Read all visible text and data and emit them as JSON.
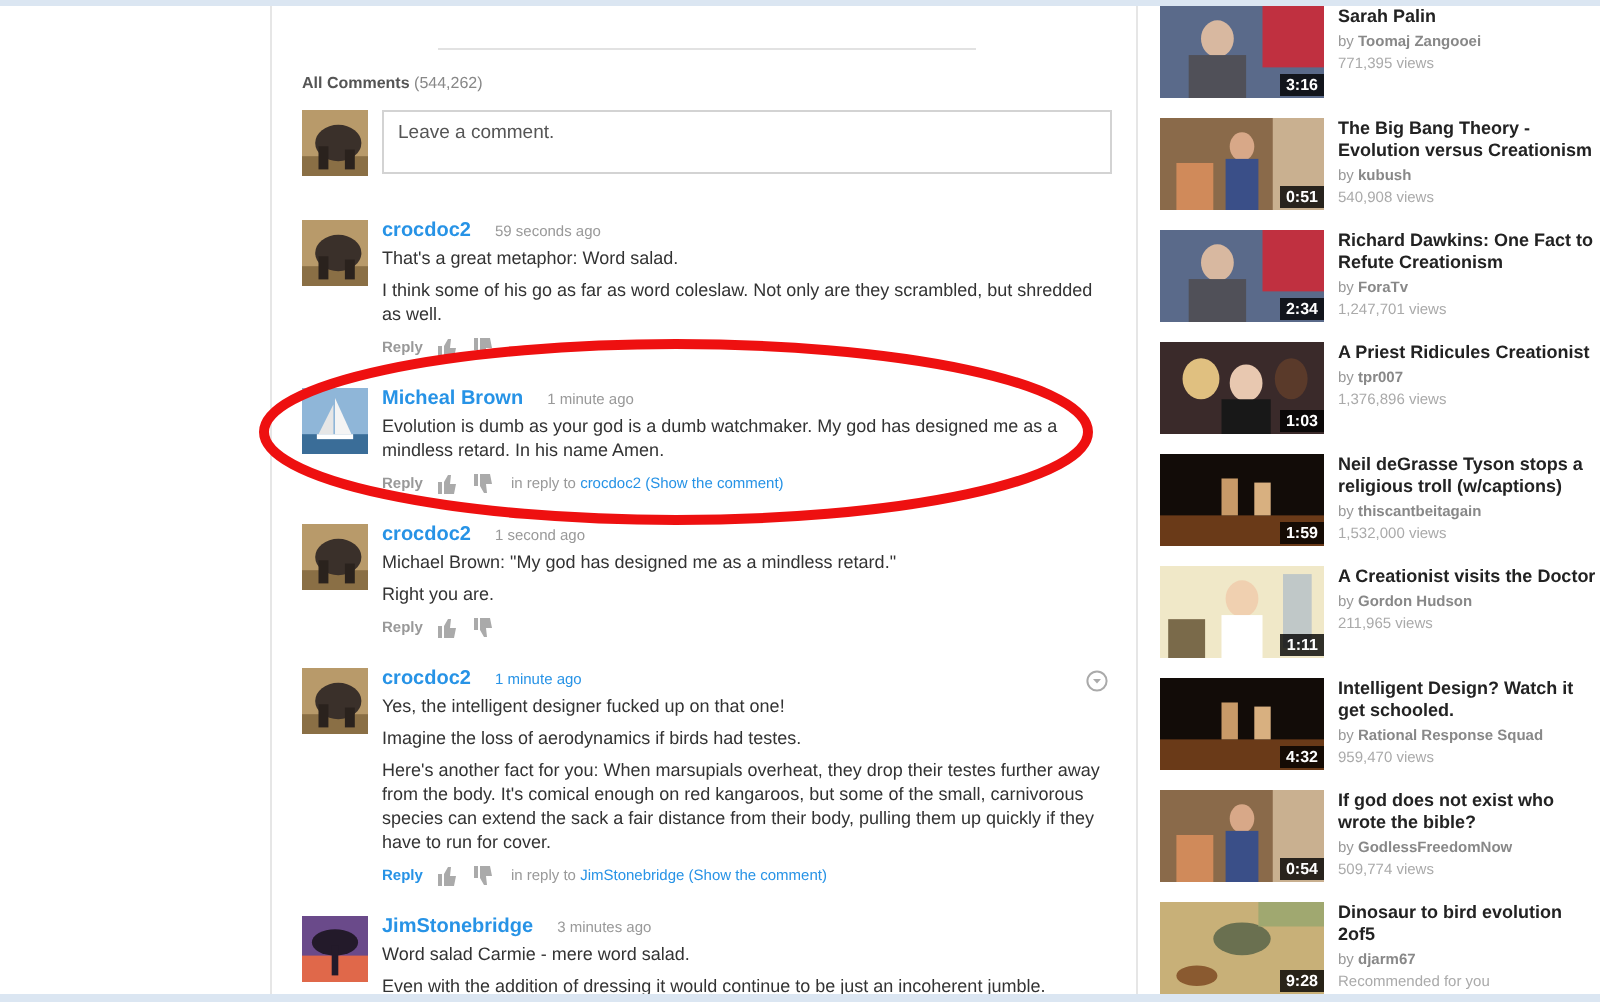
{
  "comments_section": {
    "heading": "All Comments",
    "count": "(544,262)",
    "comment_box": {
      "placeholder": "Leave a comment."
    },
    "comments": [
      {
        "author": "crocdoc2",
        "time": "59 seconds ago",
        "paragraphs": [
          "That's a great metaphor: Word salad.",
          "I think some of his go as far as word coleslaw. Not only are they scrambled, but shredded as well."
        ],
        "reply": "Reply",
        "active": false,
        "menu": false
      },
      {
        "author": "Micheal Brown",
        "time": "1 minute ago",
        "paragraphs": [
          "Evolution is dumb as your god is a dumb watchmaker. My god has designed me as a mindless retard. In his name Amen."
        ],
        "reply": "Reply",
        "reply_to_prefix": "in reply to",
        "reply_to": "crocdoc2",
        "show_comment": "(Show the comment)",
        "active": false,
        "menu": false
      },
      {
        "author": "crocdoc2",
        "time": "1 second ago",
        "paragraphs": [
          "Michael Brown: \"My god has designed me as a mindless retard.\"",
          "Right you are."
        ],
        "reply": "Reply",
        "active": false,
        "menu": false
      },
      {
        "author": "crocdoc2",
        "time": "1 minute ago",
        "paragraphs": [
          "Yes, the intelligent designer fucked up on that one!",
          "Imagine the loss of aerodynamics if birds had testes.",
          "Here's another fact for you: When marsupials overheat, they drop their testes further away from the body. It's comical enough on red kangaroos, but some of the small, carnivorous species can extend the sack a fair distance from their body, pulling them up quickly if they have to run for cover."
        ],
        "reply": "Reply",
        "reply_to_prefix": "in reply to",
        "reply_to": "JimStonebridge",
        "show_comment": "(Show the comment)",
        "active": true,
        "menu": true
      },
      {
        "author": "JimStonebridge",
        "time": "3 minutes ago",
        "paragraphs": [
          "Word salad Carmie - mere word salad.",
          "Even with the addition of dressing it would continue to be just an incoherent jumble."
        ],
        "active": false,
        "menu": false
      }
    ]
  },
  "related_videos": [
    {
      "title": "Sarah Palin",
      "by": "by",
      "channel": "Toomaj Zangooei",
      "meta": "771,395 views",
      "duration": "3:16"
    },
    {
      "title": "The Big Bang Theory - Evolution versus Creationism",
      "by": "by",
      "channel": "kubush",
      "meta": "540,908 views",
      "duration": "0:51"
    },
    {
      "title": "Richard Dawkins: One Fact to Refute Creationism",
      "by": "by",
      "channel": "ForaTv",
      "meta": "1,247,701 views",
      "duration": "2:34"
    },
    {
      "title": "A Priest Ridicules Creationist",
      "by": "by",
      "channel": "tpr007",
      "meta": "1,376,896 views",
      "duration": "1:03"
    },
    {
      "title": "Neil deGrasse Tyson stops a religious troll (w/captions)",
      "by": "by",
      "channel": "thiscantbeitagain",
      "meta": "1,532,000 views",
      "duration": "1:59"
    },
    {
      "title": "A Creationist visits the Doctor",
      "by": "by",
      "channel": "Gordon Hudson",
      "meta": "211,965 views",
      "duration": "1:11"
    },
    {
      "title": "Intelligent Design? Watch it get schooled.",
      "by": "by",
      "channel": "Rational Response Squad",
      "meta": "959,470 views",
      "duration": "4:32"
    },
    {
      "title": "If god does not exist who wrote the bible?",
      "by": "by",
      "channel": "GodlessFreedomNow",
      "meta": "509,774 views",
      "duration": "0:54"
    },
    {
      "title": "Dinosaur to bird evolution 2of5",
      "by": "by",
      "channel": "djarm67",
      "meta": "Recommended for you",
      "duration": "9:28"
    }
  ]
}
